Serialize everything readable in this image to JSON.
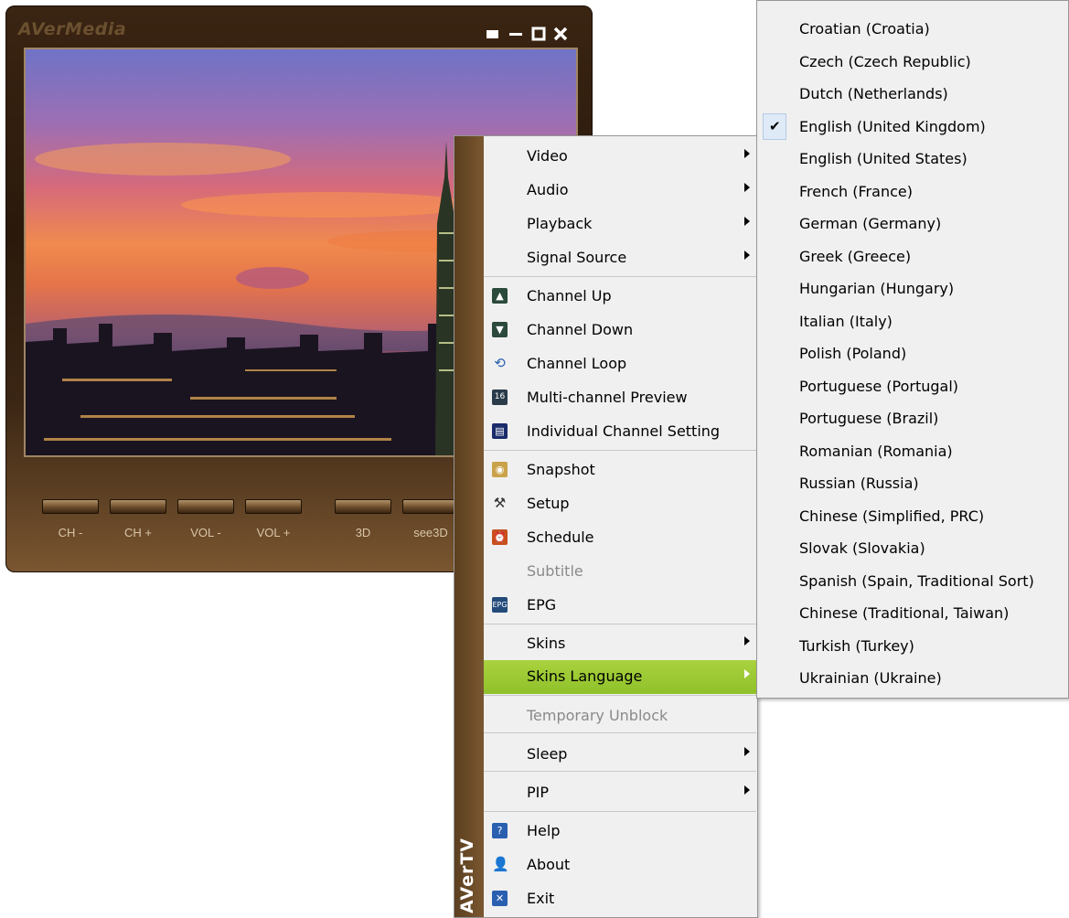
{
  "window": {
    "brand": "AVerMedia",
    "controls": [
      {
        "name": "menu",
        "glyph": "▬"
      },
      {
        "name": "minimize",
        "glyph": "—"
      },
      {
        "name": "maximize",
        "glyph": "□"
      },
      {
        "name": "close",
        "glyph": "✕"
      }
    ]
  },
  "control_buttons": [
    "CH -",
    "CH +",
    "VOL -",
    "VOL +",
    "3D",
    "see3D"
  ],
  "menu": {
    "sidebar_label": "AVerTV",
    "items": [
      {
        "label": "Video",
        "submenu": true
      },
      {
        "label": "Audio",
        "submenu": true
      },
      {
        "label": "Playback",
        "submenu": true
      },
      {
        "label": "Signal Source",
        "submenu": true
      },
      {
        "label": "Channel Up",
        "icon": "channel-up-icon"
      },
      {
        "label": "Channel Down",
        "icon": "channel-down-icon"
      },
      {
        "label": "Channel Loop",
        "icon": "loop-icon"
      },
      {
        "label": "Multi-channel Preview",
        "icon": "multi-preview-icon"
      },
      {
        "label": "Individual Channel Setting",
        "icon": "channel-setting-icon"
      },
      {
        "label": "Snapshot",
        "icon": "camera-icon"
      },
      {
        "label": "Setup",
        "icon": "hammer-icon"
      },
      {
        "label": "Schedule",
        "icon": "alarm-clock-icon"
      },
      {
        "label": "Subtitle",
        "disabled": true
      },
      {
        "label": "EPG",
        "icon": "epg-icon"
      },
      {
        "label": "Skins",
        "submenu": true
      },
      {
        "label": "Skins Language",
        "submenu": true,
        "active": true
      },
      {
        "label": "Temporary Unblock",
        "disabled": true
      },
      {
        "label": "Sleep",
        "submenu": true
      },
      {
        "label": "PIP",
        "submenu": true
      },
      {
        "label": "Help",
        "icon": "help-icon"
      },
      {
        "label": "About",
        "icon": "user-icon"
      },
      {
        "label": "Exit",
        "icon": "exit-icon"
      }
    ]
  },
  "languages": [
    "Croatian (Croatia)",
    "Czech (Czech Republic)",
    "Dutch (Netherlands)",
    "English (United Kingdom)",
    "English (United States)",
    "French (France)",
    "German (Germany)",
    "Greek (Greece)",
    "Hungarian (Hungary)",
    "Italian (Italy)",
    "Polish (Poland)",
    "Portuguese (Portugal)",
    "Portuguese (Brazil)",
    "Romanian (Romania)",
    "Russian (Russia)",
    "Chinese (Simplified, PRC)",
    "Slovak (Slovakia)",
    "Spanish (Spain, Traditional Sort)",
    "Chinese (Traditional, Taiwan)",
    "Turkish (Turkey)",
    "Ukrainian (Ukraine)"
  ],
  "selected_language": "English (United Kingdom)",
  "colors": {
    "menu_highlight": "#9acb34",
    "window_brown": "#3a2412"
  }
}
